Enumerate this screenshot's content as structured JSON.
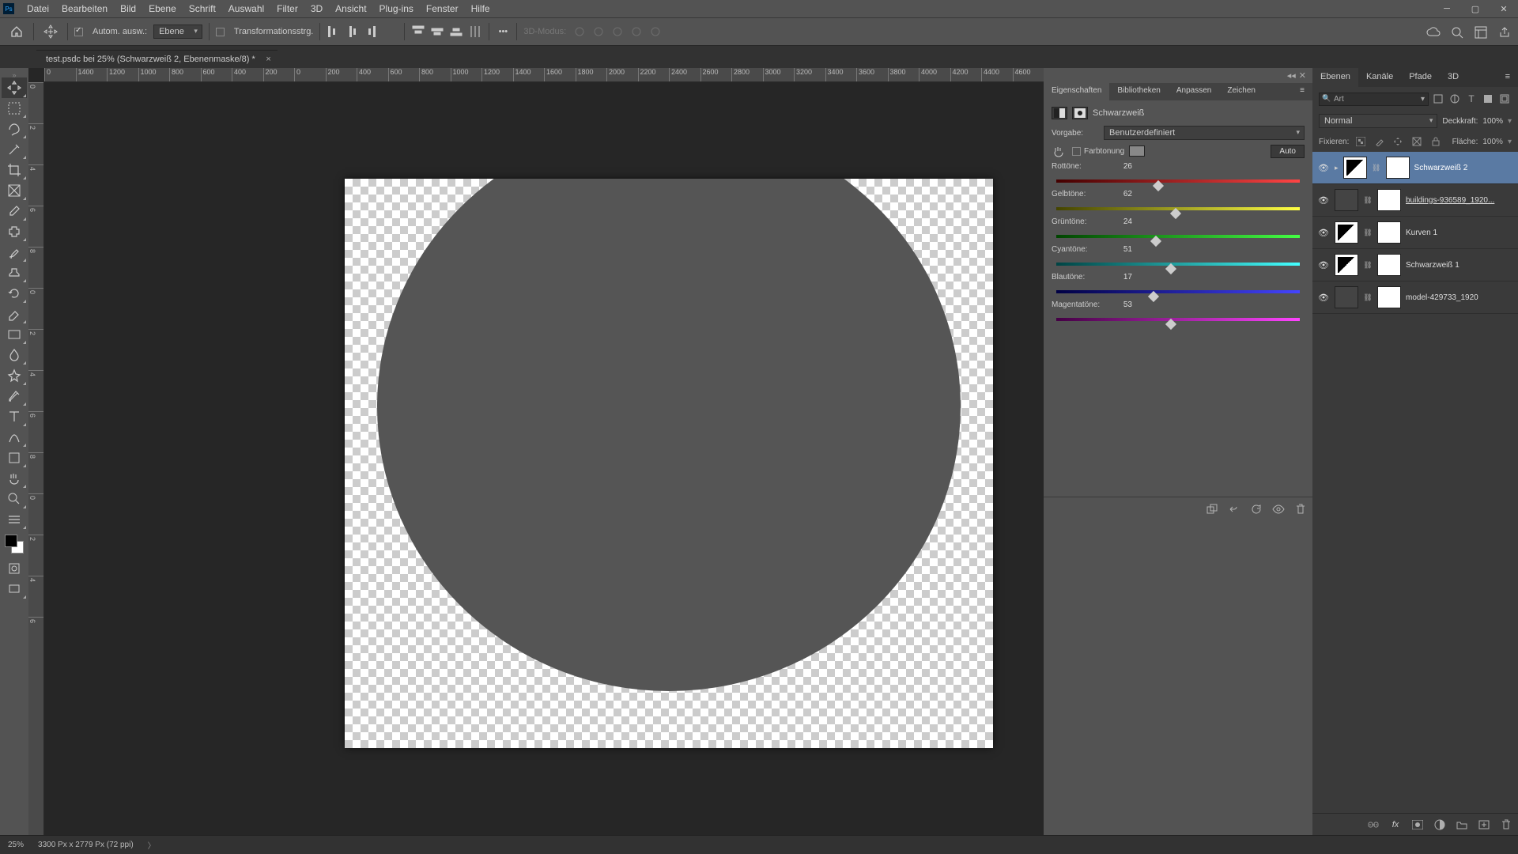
{
  "menu": [
    "Datei",
    "Bearbeiten",
    "Bild",
    "Ebene",
    "Schrift",
    "Auswahl",
    "Filter",
    "3D",
    "Ansicht",
    "Plug-ins",
    "Fenster",
    "Hilfe"
  ],
  "optbar": {
    "auto_select": "Autom. ausw.:",
    "layer_dd": "Ebene",
    "transform": "Transformationsstrg.",
    "mode3d": "3D-Modus:"
  },
  "tab": {
    "title": "test.psdc bei 25% (Schwarzweiß 2, Ebenenmaske/8) *"
  },
  "ruler_h": [
    "0",
    "1400",
    "1200",
    "1000",
    "800",
    "600",
    "400",
    "200",
    "0",
    "200",
    "400",
    "600",
    "800",
    "1000",
    "1200",
    "1400",
    "1600",
    "1800",
    "2000",
    "2200",
    "2400",
    "2600",
    "2800",
    "3000",
    "3200",
    "3400",
    "3600",
    "3800",
    "4000",
    "4200",
    "4400",
    "4600"
  ],
  "ruler_v": [
    "0",
    "2",
    "4",
    "6",
    "8",
    "0",
    "2",
    "4",
    "6",
    "8",
    "0",
    "2",
    "4",
    "6"
  ],
  "panel_tabs_top": {
    "a": "Eigenschaften",
    "b": "Bibliotheken",
    "c": "Anpassen",
    "d": "Zeichen"
  },
  "props": {
    "title": "Schwarzweiß",
    "preset_label": "Vorgabe:",
    "preset_value": "Benutzerdefiniert",
    "tint_label": "Farbtonung",
    "auto": "Auto",
    "sliders": [
      {
        "label": "Rottöne:",
        "value": 26,
        "pos": 42,
        "grad": "grad-red"
      },
      {
        "label": "Gelbtöne:",
        "value": 62,
        "pos": 49,
        "grad": "grad-yellow"
      },
      {
        "label": "Grüntöne:",
        "value": 24,
        "pos": 41,
        "grad": "grad-green"
      },
      {
        "label": "Cyantöne:",
        "value": 51,
        "pos": 47,
        "grad": "grad-cyan"
      },
      {
        "label": "Blautöne:",
        "value": 17,
        "pos": 40,
        "grad": "grad-blue"
      },
      {
        "label": "Magentatöne:",
        "value": 53,
        "pos": 47,
        "grad": "grad-mag"
      }
    ]
  },
  "layers_panel": {
    "tabs": [
      "Ebenen",
      "Kanäle",
      "Pfade",
      "3D"
    ],
    "filter": "Art",
    "blend": "Normal",
    "opacity_label": "Deckkraft:",
    "opacity_val": "100%",
    "lock_label": "Fixieren:",
    "fill_label": "Fläche:",
    "fill_val": "100%",
    "layers": [
      {
        "name": "Schwarzweiß 2",
        "sel": true,
        "adj": true,
        "eye": true,
        "clip": true
      },
      {
        "name": "buildings-936589_1920...",
        "sel": false,
        "adj": false,
        "eye": true,
        "img": true,
        "underline": true
      },
      {
        "name": "Kurven 1",
        "sel": false,
        "adj": true,
        "eye": true
      },
      {
        "name": "Schwarzweiß 1",
        "sel": false,
        "adj": true,
        "eye": true
      },
      {
        "name": "model-429733_1920",
        "sel": false,
        "adj": false,
        "eye": true,
        "img": true
      }
    ]
  },
  "status": {
    "zoom": "25%",
    "doc": "3300 Px x 2779 Px (72 ppi)"
  }
}
